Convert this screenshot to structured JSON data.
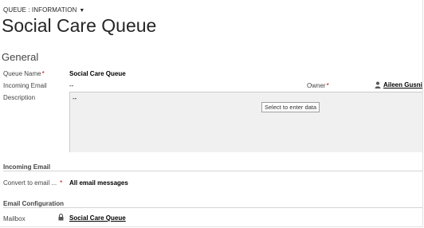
{
  "header": {
    "entity_switch_label": "QUEUE : INFORMATION",
    "caret": "▼",
    "title": "Social Care Queue"
  },
  "general": {
    "section_title": "General",
    "queue_name": {
      "label": "Queue Name",
      "required": "*",
      "value": "Social Care Queue"
    },
    "incoming_email": {
      "label": "Incoming Email",
      "value": "--"
    },
    "owner": {
      "label": "Owner",
      "required": "*",
      "value": "Aileen Gusni",
      "icon": "user-icon"
    },
    "description": {
      "label": "Description",
      "value": "--",
      "tooltip": "Select to enter data"
    }
  },
  "incoming_email_section": {
    "title": "Incoming Email",
    "convert": {
      "label": "Convert to email ...",
      "required": "*",
      "value": "All email messages"
    }
  },
  "email_config_section": {
    "title": "Email Configuration",
    "mailbox": {
      "label": "Mailbox",
      "value": "Social Care Queue",
      "icon": "lock-icon"
    }
  },
  "colors": {
    "required": "#d00000",
    "field_bg": "#f0f0f0",
    "divider": "#d4d4d4"
  }
}
